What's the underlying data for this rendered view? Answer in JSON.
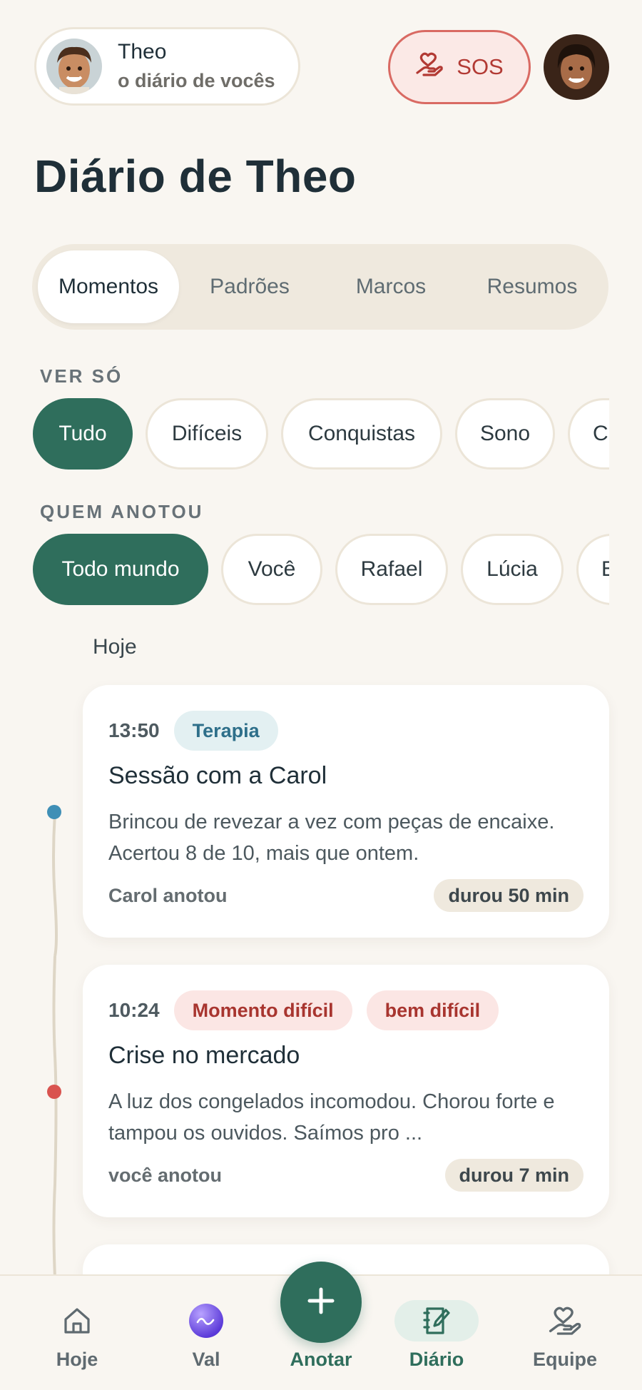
{
  "header": {
    "child_name": "Theo",
    "child_subtitle": "o diário de vocês",
    "sos_label": "SOS"
  },
  "page_title": "Diário de Theo",
  "tabs": [
    {
      "label": "Momentos",
      "active": true
    },
    {
      "label": "Padrões",
      "active": false
    },
    {
      "label": "Marcos",
      "active": false
    },
    {
      "label": "Resumos",
      "active": false
    }
  ],
  "filter_type": {
    "label": "VER SÓ",
    "chips": [
      {
        "label": "Tudo",
        "active": true
      },
      {
        "label": "Difíceis",
        "active": false
      },
      {
        "label": "Conquistas",
        "active": false
      },
      {
        "label": "Sono",
        "active": false
      },
      {
        "label": "C",
        "active": false
      }
    ]
  },
  "filter_author": {
    "label": "QUEM ANOTOU",
    "chips": [
      {
        "label": "Todo mundo",
        "active": true
      },
      {
        "label": "Você",
        "active": false
      },
      {
        "label": "Rafael",
        "active": false
      },
      {
        "label": "Lúcia",
        "active": false
      },
      {
        "label": "E",
        "active": false
      }
    ]
  },
  "day_label": "Hoje",
  "entries": [
    {
      "time": "13:50",
      "tags": [
        {
          "label": "Terapia",
          "style": "blue"
        }
      ],
      "title": "Sessão com a Carol",
      "body": "Brincou de revezar a vez com peças de encaixe. Acertou 8 de 10, mais que ontem.",
      "author": "Carol anotou",
      "duration": "durou 50 min",
      "dot_color": "#3f8fb6"
    },
    {
      "time": "10:24",
      "tags": [
        {
          "label": "Momento difícil",
          "style": "red"
        },
        {
          "label": "bem difícil",
          "style": "red"
        }
      ],
      "title": "Crise no mercado",
      "body": "A luz dos congelados incomodou. Chorou forte e tampou os ouvidos. Saímos pro ...",
      "author": "você anotou",
      "duration": "durou 7 min",
      "dot_color": "#d9534f"
    }
  ],
  "bottom_nav": {
    "items": [
      {
        "label": "Hoje",
        "icon": "home-icon"
      },
      {
        "label": "Val",
        "icon": "val-orb-icon"
      },
      {
        "label": "Diário",
        "icon": "journal-icon",
        "active": true
      },
      {
        "label": "Equipe",
        "icon": "hand-heart-icon"
      }
    ],
    "fab_label": "Anotar"
  },
  "colors": {
    "accent": "#2f6e5c",
    "background": "#f9f6f1",
    "sos": "#d96a63"
  }
}
